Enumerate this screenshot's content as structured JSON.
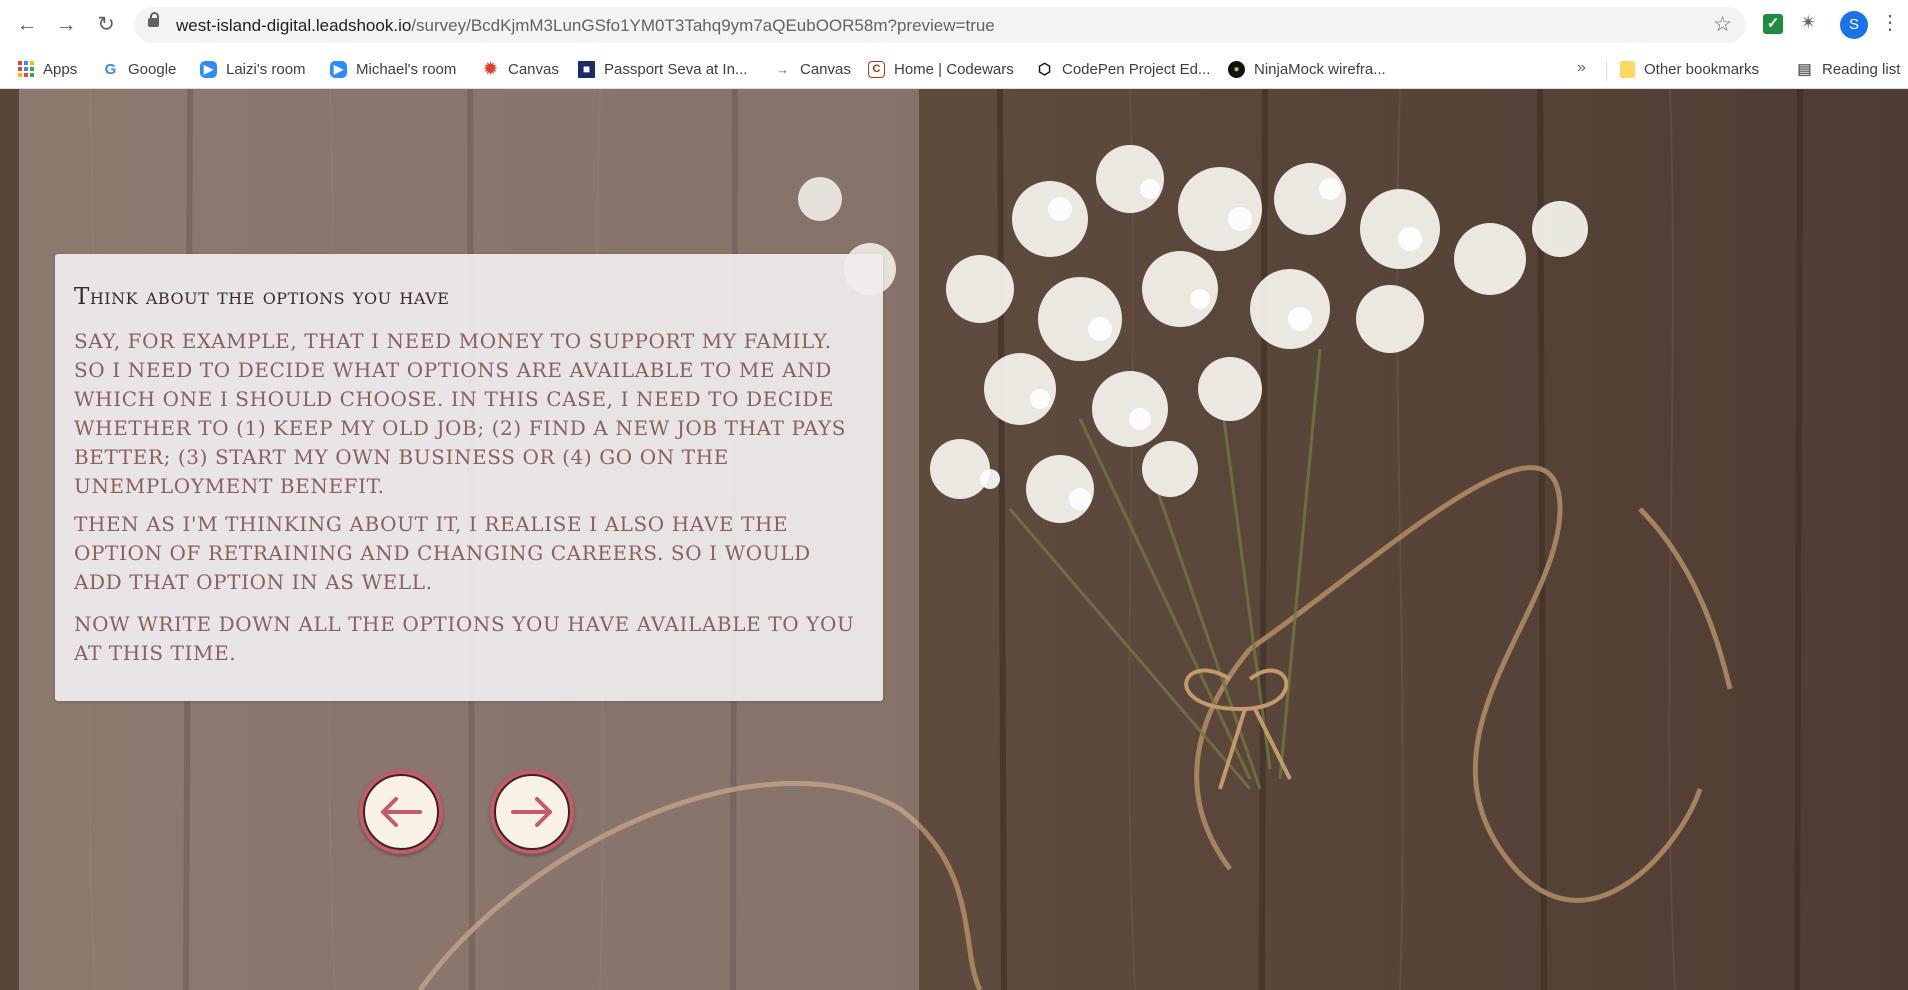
{
  "browser": {
    "url_domain": "west-island-digital.leadshook.io",
    "url_path": "/survey/BcdKjmM3LunGSfo1YM0T3Tahq9ym7aQEubOOR58m?preview=true",
    "profile_initial": "S",
    "bookmarks": [
      {
        "label": "Apps",
        "icon": "apps-grid-icon"
      },
      {
        "label": "Google",
        "icon": "google-icon"
      },
      {
        "label": "Laizi's room",
        "icon": "zoom-icon"
      },
      {
        "label": "Michael's room",
        "icon": "zoom-icon"
      },
      {
        "label": "Canvas",
        "icon": "canvas-icon"
      },
      {
        "label": "Passport Seva at In...",
        "icon": "passport-icon"
      },
      {
        "label": "Canvas",
        "icon": "arrow-icon"
      },
      {
        "label": "Home | Codewars",
        "icon": "codewars-icon"
      },
      {
        "label": "CodePen Project Ed...",
        "icon": "codepen-icon"
      },
      {
        "label": "NinjaMock wirefra...",
        "icon": "ninjamock-icon"
      }
    ],
    "overflow_label": "»",
    "other_bookmarks": "Other bookmarks",
    "reading_list": "Reading list"
  },
  "survey": {
    "title": "Think about the options you have",
    "paragraphs": [
      "Say, for example, that I need money to support my family.  So I need to decide what options are available to me and which one I should choose.  In this case, I need to decide whether to (1) keep my old job; (2) find a new job that pays better; (3) start my own business or (4) go on the unemployment benefit.",
      "Then as I'm thinking about it, I realise I also have the option of retraining and changing careers.  So I would add that option in as well.",
      "Now write down all the options you have available to you at this time."
    ]
  },
  "colors": {
    "card_background": "#f0edee",
    "title_text": "#3b2b26",
    "body_text": "#8a6060",
    "button_ring": "#c45a6a",
    "button_fill": "#f7f1e6"
  },
  "navigation": {
    "back_icon": "arrow-left-icon",
    "next_icon": "arrow-right-icon"
  }
}
